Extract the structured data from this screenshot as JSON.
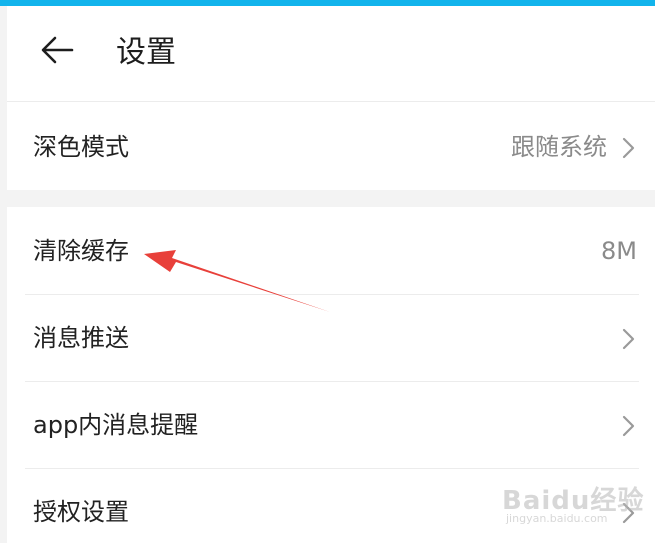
{
  "header": {
    "title": "设置",
    "back_icon": "arrow-left-icon"
  },
  "settings": {
    "dark_mode": {
      "label": "深色模式",
      "value": "跟随系统"
    },
    "clear_cache": {
      "label": "清除缓存",
      "value": "8M"
    },
    "push": {
      "label": "消息推送"
    },
    "in_app": {
      "label": "app内消息提醒"
    },
    "auth": {
      "label": "授权设置"
    }
  },
  "annotation": {
    "color": "#e8403a",
    "points_to": "clear_cache"
  },
  "watermark": {
    "main": "Baidu经验",
    "sub": "jingyan.baidu.com"
  },
  "colors": {
    "top_bar": "#12b4ec",
    "background": "#f3f3f3"
  }
}
